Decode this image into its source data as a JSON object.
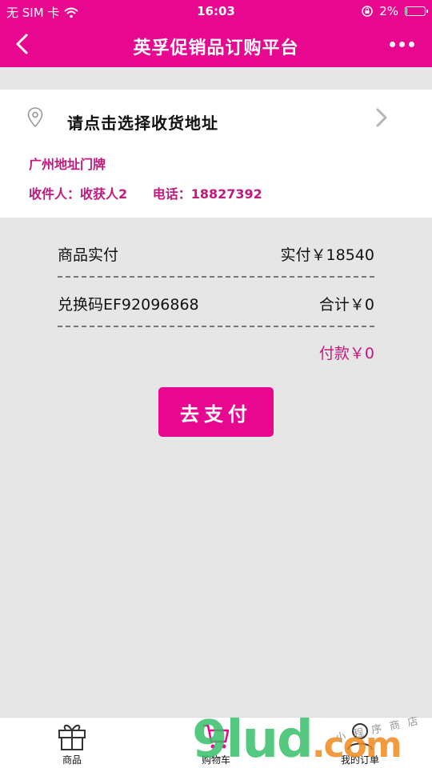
{
  "status": {
    "carrier": "无 SIM 卡",
    "time": "16:03",
    "battery": "2%",
    "battery_level": 0.02
  },
  "nav": {
    "title": "英孚促销品订购平台"
  },
  "address": {
    "select_prompt": "请点击选择收货地址",
    "detail": "广州地址门牌",
    "recipient": "收件人：收获人2",
    "phone": "电话：18827392"
  },
  "order": {
    "product_label": "商品实付",
    "paid_amount": "实付￥18540",
    "code_label": "兑换码EF92096868",
    "total": "合计￥0",
    "payment": "付款￥0"
  },
  "pay_button": "去支付",
  "tabs": [
    {
      "label": "商品",
      "icon": "gift-icon"
    },
    {
      "label": "购物车",
      "icon": "cart-icon"
    },
    {
      "label": "我的订单",
      "icon": "user-icon"
    }
  ],
  "watermark": {
    "text": "9lud",
    "suffix": ".com",
    "sub": "小程序商店"
  },
  "colors": {
    "brand": "#e8078f",
    "accent_text": "#c2197f",
    "background": "#e6e6e6"
  }
}
